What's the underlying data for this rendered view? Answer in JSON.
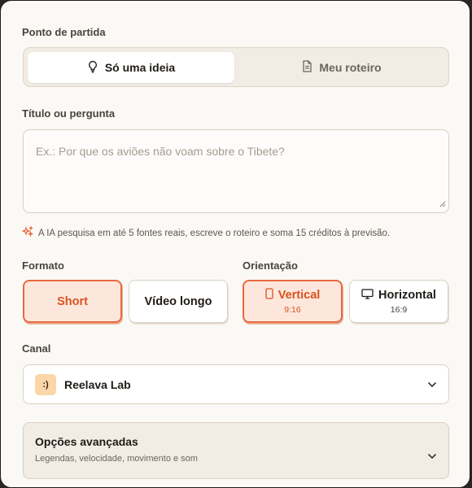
{
  "starting_point": {
    "label": "Ponto de partida",
    "options": [
      {
        "label": "Só uma ideia",
        "icon": "lightbulb-icon"
      },
      {
        "label": "Meu roteiro",
        "icon": "document-icon"
      }
    ]
  },
  "title_field": {
    "label": "Título ou pergunta",
    "placeholder": "Ex.: Por que os aviões não voam sobre o Tibete?",
    "value": ""
  },
  "hint": {
    "icon": "sparkles-icon",
    "text": "A IA pesquisa em até 5 fontes reais, escreve o roteiro e soma 15 créditos à previsão."
  },
  "format": {
    "label": "Formato",
    "options": [
      {
        "label": "Short",
        "selected": true
      },
      {
        "label": "Vídeo longo",
        "selected": false
      }
    ]
  },
  "orientation": {
    "label": "Orientação",
    "options": [
      {
        "label": "Vertical",
        "sub": "9:16",
        "icon": "phone-icon",
        "selected": true
      },
      {
        "label": "Horizontal",
        "sub": "16:9",
        "icon": "monitor-icon",
        "selected": false
      }
    ]
  },
  "channel": {
    "label": "Canal",
    "avatar": ":)",
    "value": "Reelava Lab"
  },
  "advanced": {
    "title": "Opções avançadas",
    "subtitle": "Legendas, velocidade, movimento e som"
  },
  "colors": {
    "accent": "#e8693e",
    "accent_bg": "#fde7dc",
    "background": "#fbf9f5"
  }
}
